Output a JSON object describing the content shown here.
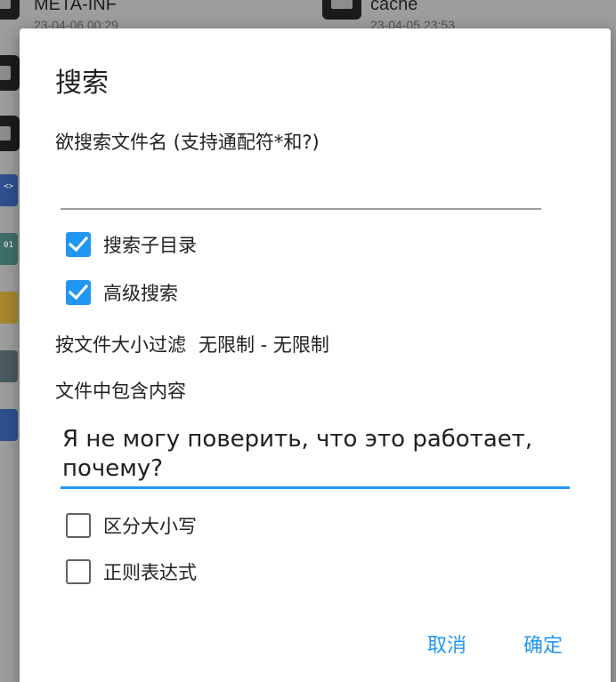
{
  "background": {
    "items": [
      {
        "name": "META-INF",
        "date": "23-04-06 00:29"
      },
      {
        "name": "cache",
        "date": "23-04-05 23:53"
      }
    ],
    "file_icons": [
      {
        "label": "<>",
        "color": "#2f4f8f"
      },
      {
        "label": "01",
        "color": "#3f6f6a"
      },
      {
        "label": "",
        "color": "#a8862f"
      },
      {
        "label": "",
        "color": "#4a5a60"
      },
      {
        "label": "",
        "color": "#2f4f8f"
      }
    ]
  },
  "dialog": {
    "title": "搜索",
    "filename_label": "欲搜索文件名 (支持通配符*和?)",
    "filename_value": "",
    "options": [
      {
        "label": "搜索子目录",
        "checked": true
      },
      {
        "label": "高级搜索",
        "checked": true
      }
    ],
    "size_filter_label": "按文件大小过滤",
    "size_filter_value": "无限制 - 无限制",
    "content_label": "文件中包含内容",
    "content_value": "Я не могу поверить, что это работает, почему?",
    "advanced_options": [
      {
        "label": "区分大小写",
        "checked": false
      },
      {
        "label": "正则表达式",
        "checked": false
      }
    ],
    "cancel_label": "取消",
    "ok_label": "确定"
  },
  "colors": {
    "accent": "#2196f3",
    "checkbox_border": "#616161"
  }
}
